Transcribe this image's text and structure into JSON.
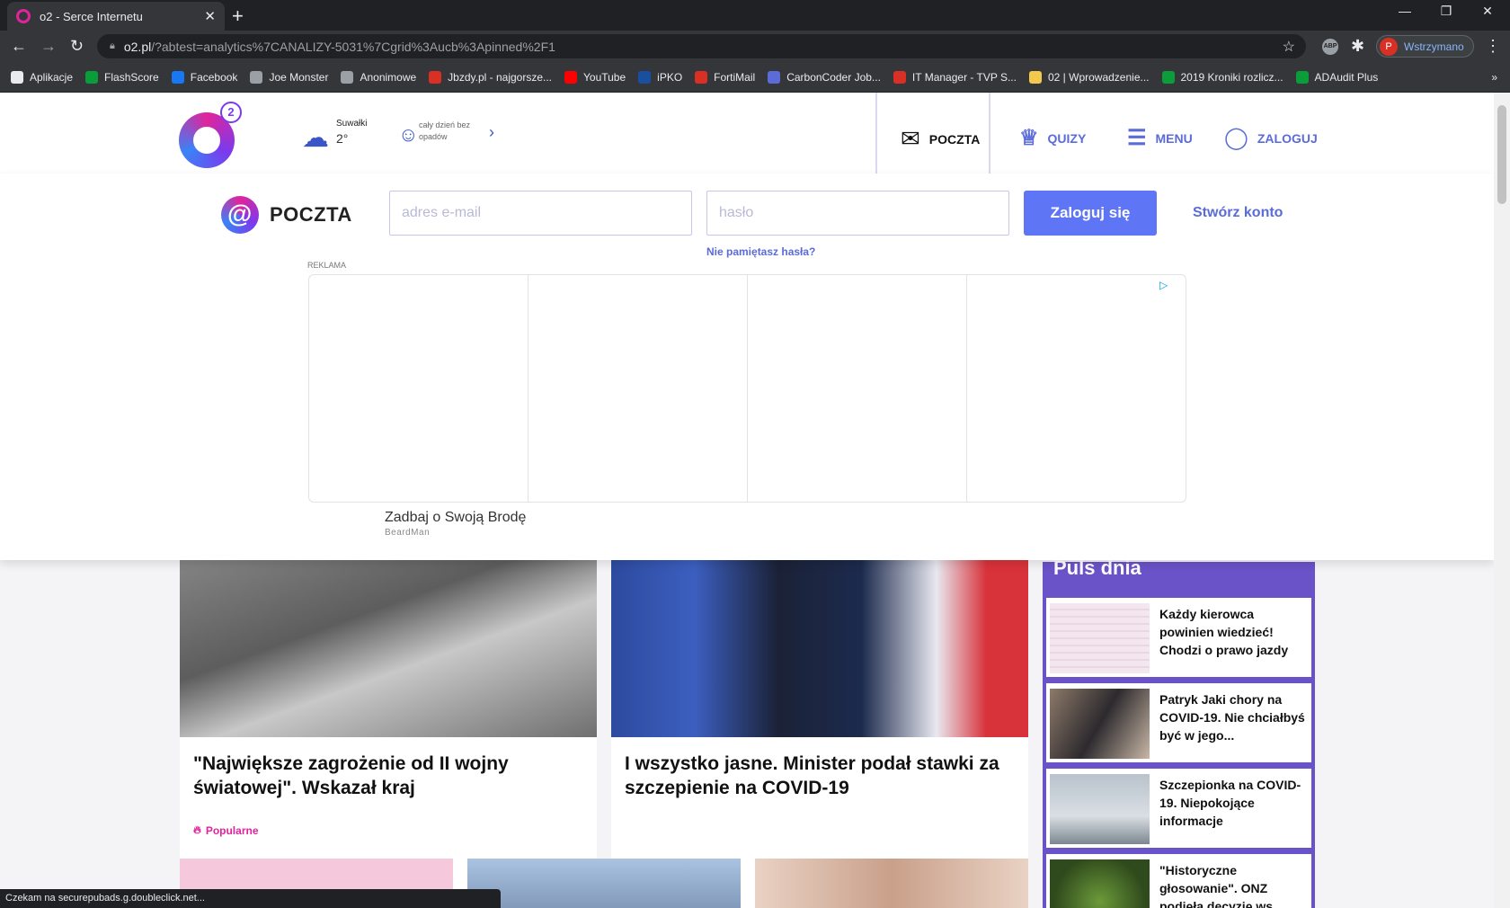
{
  "browser": {
    "tab_title": "o2 - Serce Internetu",
    "url_host": "o2.pl",
    "url_rest": "/?abtest=analytics%7CANALIZY-5031%7Cgrid%3Aucb%3Apinned%2F1",
    "profile_initial": "P",
    "profile_label": "Wstrzymano",
    "status_text": "Czekam na securepubads.g.doubleclick.net..."
  },
  "bookmarks": [
    {
      "label": "Aplikacje",
      "color": "#e8eaed"
    },
    {
      "label": "FlashScore",
      "color": "#0a9d3a"
    },
    {
      "label": "Facebook",
      "color": "#1877f2"
    },
    {
      "label": "Joe Monster",
      "color": "#9aa0a6"
    },
    {
      "label": "Anonimowe",
      "color": "#9aa0a6"
    },
    {
      "label": "Jbzdy.pl - najgorsze...",
      "color": "#d93025"
    },
    {
      "label": "YouTube",
      "color": "#ff0000"
    },
    {
      "label": "iPKO",
      "color": "#1a4fa0"
    },
    {
      "label": "FortiMail",
      "color": "#d93025"
    },
    {
      "label": "CarbonCoder Job...",
      "color": "#5b6bd8"
    },
    {
      "label": "IT Manager - TVP S...",
      "color": "#d93025"
    },
    {
      "label": "02 | Wprowadzenie...",
      "color": "#f2c94c"
    },
    {
      "label": "2019 Kroniki rozlicz...",
      "color": "#0a9d3a"
    },
    {
      "label": "ADAudit Plus",
      "color": "#0a9d3a"
    }
  ],
  "header": {
    "weather_city": "Suwałki",
    "weather_temp": "2°",
    "weather_desc": "cały dzień bez opadów",
    "nav": {
      "mail": "POCZTA",
      "quiz": "QUIZY",
      "menu": "MENU",
      "login": "ZALOGUJ"
    },
    "logo_sup": "2"
  },
  "mail_panel": {
    "title": "POCZTA",
    "email_placeholder": "adres e-mail",
    "password_placeholder": "hasło",
    "login_button": "Zaloguj się",
    "create_account": "Stwórz konto",
    "forgot_password": "Nie pamiętasz hasła?",
    "ad_label": "REKLAMA",
    "ad_headline": "Zadbaj o Swoją Brodę",
    "ad_brand": "BeardMan"
  },
  "articles": [
    {
      "title": "\"Największe zagrożenie od II wojny światowej\". Wskazał kraj",
      "tag": "Popularne"
    },
    {
      "title": "I wszystko jasne. Minister podał stawki za szczepienie na COVID-19"
    }
  ],
  "puls": {
    "title": "Puls dnia",
    "items": [
      {
        "text": "Każdy kierowca powinien wiedzieć! Chodzi o prawo jazdy"
      },
      {
        "text": "Patryk Jaki chory na COVID-19. Nie chciałbyś być w jego..."
      },
      {
        "text": "Szczepionka na COVID-19. Niepokojące informacje"
      },
      {
        "text": "\"Historyczne głosowanie\". ONZ podjęła decyzję ws...."
      }
    ]
  },
  "colors": {
    "brand_pink": "#e0249c",
    "brand_blue": "#5b6bd8",
    "button_blue": "#5e75f5",
    "puls_purple": "#6a52c8"
  }
}
